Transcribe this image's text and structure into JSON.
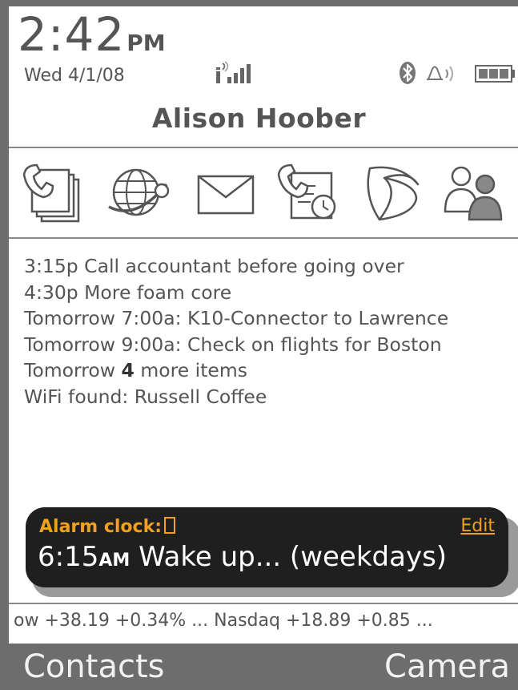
{
  "status": {
    "time": "2:42",
    "ampm": "PM",
    "date": "Wed 4/1/08",
    "signal_icon": "signal-strength-icon",
    "bluetooth_icon": "bluetooth-icon",
    "alarm_icon": "alarm-bell-icon",
    "battery_icon": "battery-icon"
  },
  "owner_name": "Alison Hoober",
  "apps": [
    {
      "icon": "phone-contacts-icon"
    },
    {
      "icon": "web-browser-icon"
    },
    {
      "icon": "mail-icon"
    },
    {
      "icon": "call-log-icon"
    },
    {
      "icon": "carrier-service-icon"
    },
    {
      "icon": "contacts-people-icon"
    }
  ],
  "agenda": {
    "items": [
      "3:15p Call accountant before going over",
      "4:30p More foam core",
      "Tomorrow 7:00a: K10-Connector to Lawrence",
      "Tomorrow 9:00a: Check on flights for Boston"
    ],
    "more_prefix": "Tomorrow",
    "more_count": "4",
    "more_suffix": "more items",
    "wifi": "WiFi found: Russell Coffee"
  },
  "alarm": {
    "label": "Alarm clock:",
    "edit_label": "Edit",
    "time": "6:15",
    "ampm": "AM",
    "text": "Wake up... (weekdays)"
  },
  "ticker": {
    "text": "ow +38.19 +0.34% ... Nasdaq +18.89 +0.85 ..."
  },
  "softkeys": {
    "left": "Contacts",
    "right": "Camera"
  },
  "colors": {
    "frame": "#6d6d6d",
    "text": "#555555",
    "alarm_bg": "#1f1f1f",
    "alarm_accent": "#f0a020"
  }
}
